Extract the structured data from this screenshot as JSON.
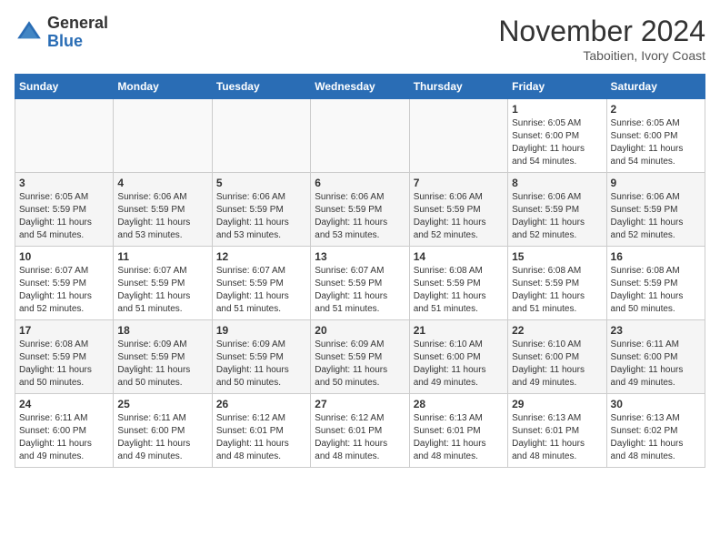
{
  "header": {
    "logo_general": "General",
    "logo_blue": "Blue",
    "month_title": "November 2024",
    "location": "Taboitien, Ivory Coast"
  },
  "weekdays": [
    "Sunday",
    "Monday",
    "Tuesday",
    "Wednesday",
    "Thursday",
    "Friday",
    "Saturday"
  ],
  "weeks": [
    [
      {
        "day": "",
        "info": ""
      },
      {
        "day": "",
        "info": ""
      },
      {
        "day": "",
        "info": ""
      },
      {
        "day": "",
        "info": ""
      },
      {
        "day": "",
        "info": ""
      },
      {
        "day": "1",
        "info": "Sunrise: 6:05 AM\nSunset: 6:00 PM\nDaylight: 11 hours\nand 54 minutes."
      },
      {
        "day": "2",
        "info": "Sunrise: 6:05 AM\nSunset: 6:00 PM\nDaylight: 11 hours\nand 54 minutes."
      }
    ],
    [
      {
        "day": "3",
        "info": "Sunrise: 6:05 AM\nSunset: 5:59 PM\nDaylight: 11 hours\nand 54 minutes."
      },
      {
        "day": "4",
        "info": "Sunrise: 6:06 AM\nSunset: 5:59 PM\nDaylight: 11 hours\nand 53 minutes."
      },
      {
        "day": "5",
        "info": "Sunrise: 6:06 AM\nSunset: 5:59 PM\nDaylight: 11 hours\nand 53 minutes."
      },
      {
        "day": "6",
        "info": "Sunrise: 6:06 AM\nSunset: 5:59 PM\nDaylight: 11 hours\nand 53 minutes."
      },
      {
        "day": "7",
        "info": "Sunrise: 6:06 AM\nSunset: 5:59 PM\nDaylight: 11 hours\nand 52 minutes."
      },
      {
        "day": "8",
        "info": "Sunrise: 6:06 AM\nSunset: 5:59 PM\nDaylight: 11 hours\nand 52 minutes."
      },
      {
        "day": "9",
        "info": "Sunrise: 6:06 AM\nSunset: 5:59 PM\nDaylight: 11 hours\nand 52 minutes."
      }
    ],
    [
      {
        "day": "10",
        "info": "Sunrise: 6:07 AM\nSunset: 5:59 PM\nDaylight: 11 hours\nand 52 minutes."
      },
      {
        "day": "11",
        "info": "Sunrise: 6:07 AM\nSunset: 5:59 PM\nDaylight: 11 hours\nand 51 minutes."
      },
      {
        "day": "12",
        "info": "Sunrise: 6:07 AM\nSunset: 5:59 PM\nDaylight: 11 hours\nand 51 minutes."
      },
      {
        "day": "13",
        "info": "Sunrise: 6:07 AM\nSunset: 5:59 PM\nDaylight: 11 hours\nand 51 minutes."
      },
      {
        "day": "14",
        "info": "Sunrise: 6:08 AM\nSunset: 5:59 PM\nDaylight: 11 hours\nand 51 minutes."
      },
      {
        "day": "15",
        "info": "Sunrise: 6:08 AM\nSunset: 5:59 PM\nDaylight: 11 hours\nand 51 minutes."
      },
      {
        "day": "16",
        "info": "Sunrise: 6:08 AM\nSunset: 5:59 PM\nDaylight: 11 hours\nand 50 minutes."
      }
    ],
    [
      {
        "day": "17",
        "info": "Sunrise: 6:08 AM\nSunset: 5:59 PM\nDaylight: 11 hours\nand 50 minutes."
      },
      {
        "day": "18",
        "info": "Sunrise: 6:09 AM\nSunset: 5:59 PM\nDaylight: 11 hours\nand 50 minutes."
      },
      {
        "day": "19",
        "info": "Sunrise: 6:09 AM\nSunset: 5:59 PM\nDaylight: 11 hours\nand 50 minutes."
      },
      {
        "day": "20",
        "info": "Sunrise: 6:09 AM\nSunset: 5:59 PM\nDaylight: 11 hours\nand 50 minutes."
      },
      {
        "day": "21",
        "info": "Sunrise: 6:10 AM\nSunset: 6:00 PM\nDaylight: 11 hours\nand 49 minutes."
      },
      {
        "day": "22",
        "info": "Sunrise: 6:10 AM\nSunset: 6:00 PM\nDaylight: 11 hours\nand 49 minutes."
      },
      {
        "day": "23",
        "info": "Sunrise: 6:11 AM\nSunset: 6:00 PM\nDaylight: 11 hours\nand 49 minutes."
      }
    ],
    [
      {
        "day": "24",
        "info": "Sunrise: 6:11 AM\nSunset: 6:00 PM\nDaylight: 11 hours\nand 49 minutes."
      },
      {
        "day": "25",
        "info": "Sunrise: 6:11 AM\nSunset: 6:00 PM\nDaylight: 11 hours\nand 49 minutes."
      },
      {
        "day": "26",
        "info": "Sunrise: 6:12 AM\nSunset: 6:01 PM\nDaylight: 11 hours\nand 48 minutes."
      },
      {
        "day": "27",
        "info": "Sunrise: 6:12 AM\nSunset: 6:01 PM\nDaylight: 11 hours\nand 48 minutes."
      },
      {
        "day": "28",
        "info": "Sunrise: 6:13 AM\nSunset: 6:01 PM\nDaylight: 11 hours\nand 48 minutes."
      },
      {
        "day": "29",
        "info": "Sunrise: 6:13 AM\nSunset: 6:01 PM\nDaylight: 11 hours\nand 48 minutes."
      },
      {
        "day": "30",
        "info": "Sunrise: 6:13 AM\nSunset: 6:02 PM\nDaylight: 11 hours\nand 48 minutes."
      }
    ]
  ]
}
